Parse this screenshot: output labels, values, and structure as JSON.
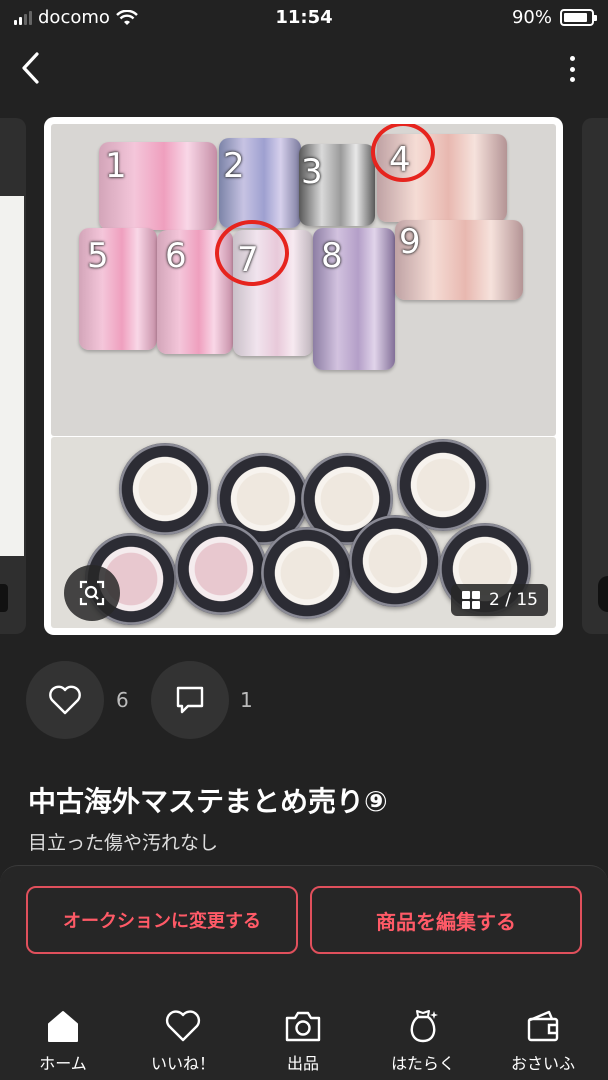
{
  "status_bar": {
    "carrier": "docomo",
    "time": "11:54",
    "battery": "90%",
    "battery_level": 0.9
  },
  "nav": {
    "back_icon": "chevron-left-icon",
    "more_icon": "vertical-dots-icon"
  },
  "photo": {
    "labels": [
      "1",
      "2",
      "3",
      "4",
      "5",
      "6",
      "7",
      "8",
      "9"
    ],
    "circled_labels": [
      "4",
      "7"
    ],
    "page_indicator": "2 / 15",
    "zoom_icon": "zoom-scan-icon",
    "grid_icon": "grid-icon"
  },
  "reactions": {
    "likes": "6",
    "comments": "1"
  },
  "item": {
    "title": "中古海外マステまとめ売り⑨",
    "condition": "目立った傷や汚れなし"
  },
  "actions": {
    "auction_label": "オークションに変更する",
    "edit_label": "商品を編集する",
    "accent_color": "#ff5a67"
  },
  "tabs": [
    {
      "label": "ホーム",
      "icon": "home-icon"
    },
    {
      "label": "いいね！",
      "icon": "heart-icon"
    },
    {
      "label": "出品",
      "icon": "camera-icon"
    },
    {
      "label": "はたらく",
      "icon": "money-bag-icon"
    },
    {
      "label": "おさいふ",
      "icon": "wallet-icon"
    }
  ]
}
